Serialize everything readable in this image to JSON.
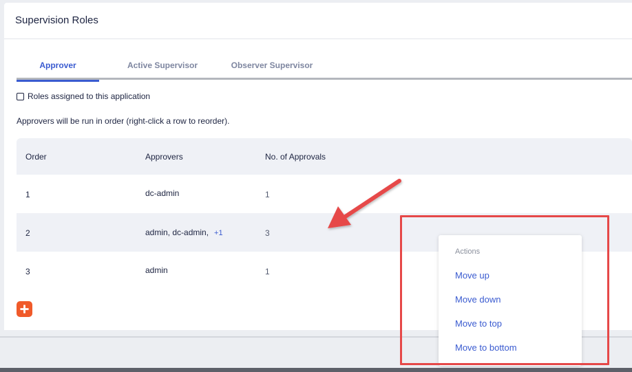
{
  "card": {
    "title": "Supervision Roles"
  },
  "tabs": [
    {
      "label": "Approver",
      "active": true
    },
    {
      "label": "Active Supervisor",
      "active": false
    },
    {
      "label": "Observer Supervisor",
      "active": false
    }
  ],
  "checkbox": {
    "label": "Roles assigned to this application",
    "checked": false
  },
  "hint": "Approvers will be run in order (right-click a row to reorder).",
  "table": {
    "headers": [
      "Order",
      "Approvers",
      "No. of Approvals"
    ],
    "rows": [
      {
        "order": "1",
        "approvers": "dc-admin",
        "more": "",
        "approvals": "1"
      },
      {
        "order": "2",
        "approvers": "admin, dc-admin,",
        "more": "+1",
        "approvals": "3"
      },
      {
        "order": "3",
        "approvers": "admin",
        "more": "",
        "approvals": "1"
      }
    ]
  },
  "add_button": {
    "icon": "plus-icon"
  },
  "context_menu": {
    "section": "Actions",
    "items": [
      "Move up",
      "Move down",
      "Move to top",
      "Move to bottom"
    ]
  },
  "colors": {
    "accent": "#3a5bd0",
    "add_button": "#f05a2a",
    "annotation_red": "#e64848"
  }
}
